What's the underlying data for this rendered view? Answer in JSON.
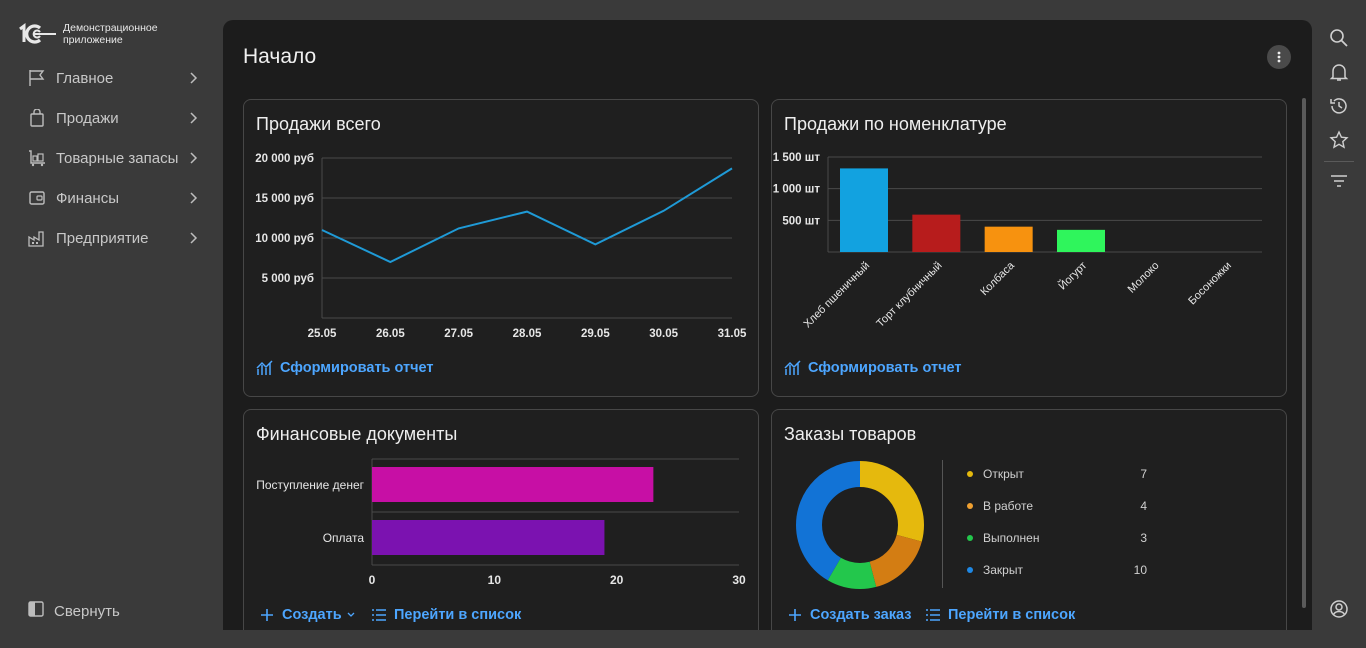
{
  "app": {
    "name": "Демонстрационное приложение",
    "logo_text": "1С"
  },
  "sidebar": {
    "items": [
      {
        "label": "Главное",
        "icon": "flag-icon"
      },
      {
        "label": "Продажи",
        "icon": "shopping-bag-icon"
      },
      {
        "label": "Товарные запасы",
        "icon": "warehouse-cart-icon"
      },
      {
        "label": "Финансы",
        "icon": "wallet-icon"
      },
      {
        "label": "Предприятие",
        "icon": "factory-icon"
      }
    ],
    "collapse_label": "Свернуть"
  },
  "page": {
    "title": "Начало"
  },
  "cards": {
    "sales_total": {
      "title": "Продажи всего",
      "action": "Сформировать отчет"
    },
    "sales_by_item": {
      "title": "Продажи по номенклатуре",
      "action": "Сформировать отчет"
    },
    "finance_docs": {
      "title": "Финансовые документы",
      "create": "Создать",
      "go_to_list": "Перейти в список"
    },
    "orders": {
      "title": "Заказы товаров",
      "create_order": "Создать заказ",
      "go_to_list": "Перейти в список"
    }
  },
  "colors": {
    "accent": "#4da6ff",
    "line": "#1f9ad6"
  },
  "chart_data": [
    {
      "type": "line",
      "title": "Продажи всего",
      "x": [
        "25.05",
        "26.05",
        "27.05",
        "28.05",
        "29.05",
        "30.05",
        "31.05"
      ],
      "y_ticks": [
        "5 000 руб",
        "10 000 руб",
        "15 000 руб",
        "20 000 руб"
      ],
      "series": [
        {
          "values": [
            11000,
            7000,
            11200,
            13300,
            9200,
            13400,
            18700
          ]
        }
      ],
      "ylim": [
        0,
        20000
      ],
      "grid": true
    },
    {
      "type": "bar",
      "title": "Продажи по номенклатуре",
      "categories": [
        "Хлеб пшеничный",
        "Торт клубничный",
        "Колбаса",
        "Йогурт",
        "Молоко",
        "Босоножки"
      ],
      "values": [
        1320,
        590,
        400,
        350,
        0,
        0
      ],
      "colors": [
        "#12a2e0",
        "#b71c1c",
        "#f7920f",
        "#2ff55c",
        "#888888",
        "#888888"
      ],
      "y_ticks": [
        "500 шт",
        "1 000 шт",
        "1 500 шт"
      ],
      "ylim": [
        0,
        1500
      ],
      "grid": true
    },
    {
      "type": "bar",
      "orientation": "horizontal",
      "title": "Финансовые документы",
      "categories": [
        "Поступление денег",
        "Оплата"
      ],
      "values": [
        23,
        19
      ],
      "colors": [
        "#c70fa5",
        "#7b12b0"
      ],
      "x_ticks": [
        "0",
        "10",
        "20",
        "30"
      ],
      "xlim": [
        0,
        30
      ]
    },
    {
      "type": "pie",
      "donut": true,
      "title": "Заказы товаров",
      "categories": [
        "Открыт",
        "В работе",
        "Выполнен",
        "Закрыт"
      ],
      "values": [
        7,
        4,
        3,
        10
      ],
      "colors": [
        "#e5b90d",
        "#d37d13",
        "#23c74c",
        "#1273d6"
      ],
      "legend": "right"
    }
  ]
}
